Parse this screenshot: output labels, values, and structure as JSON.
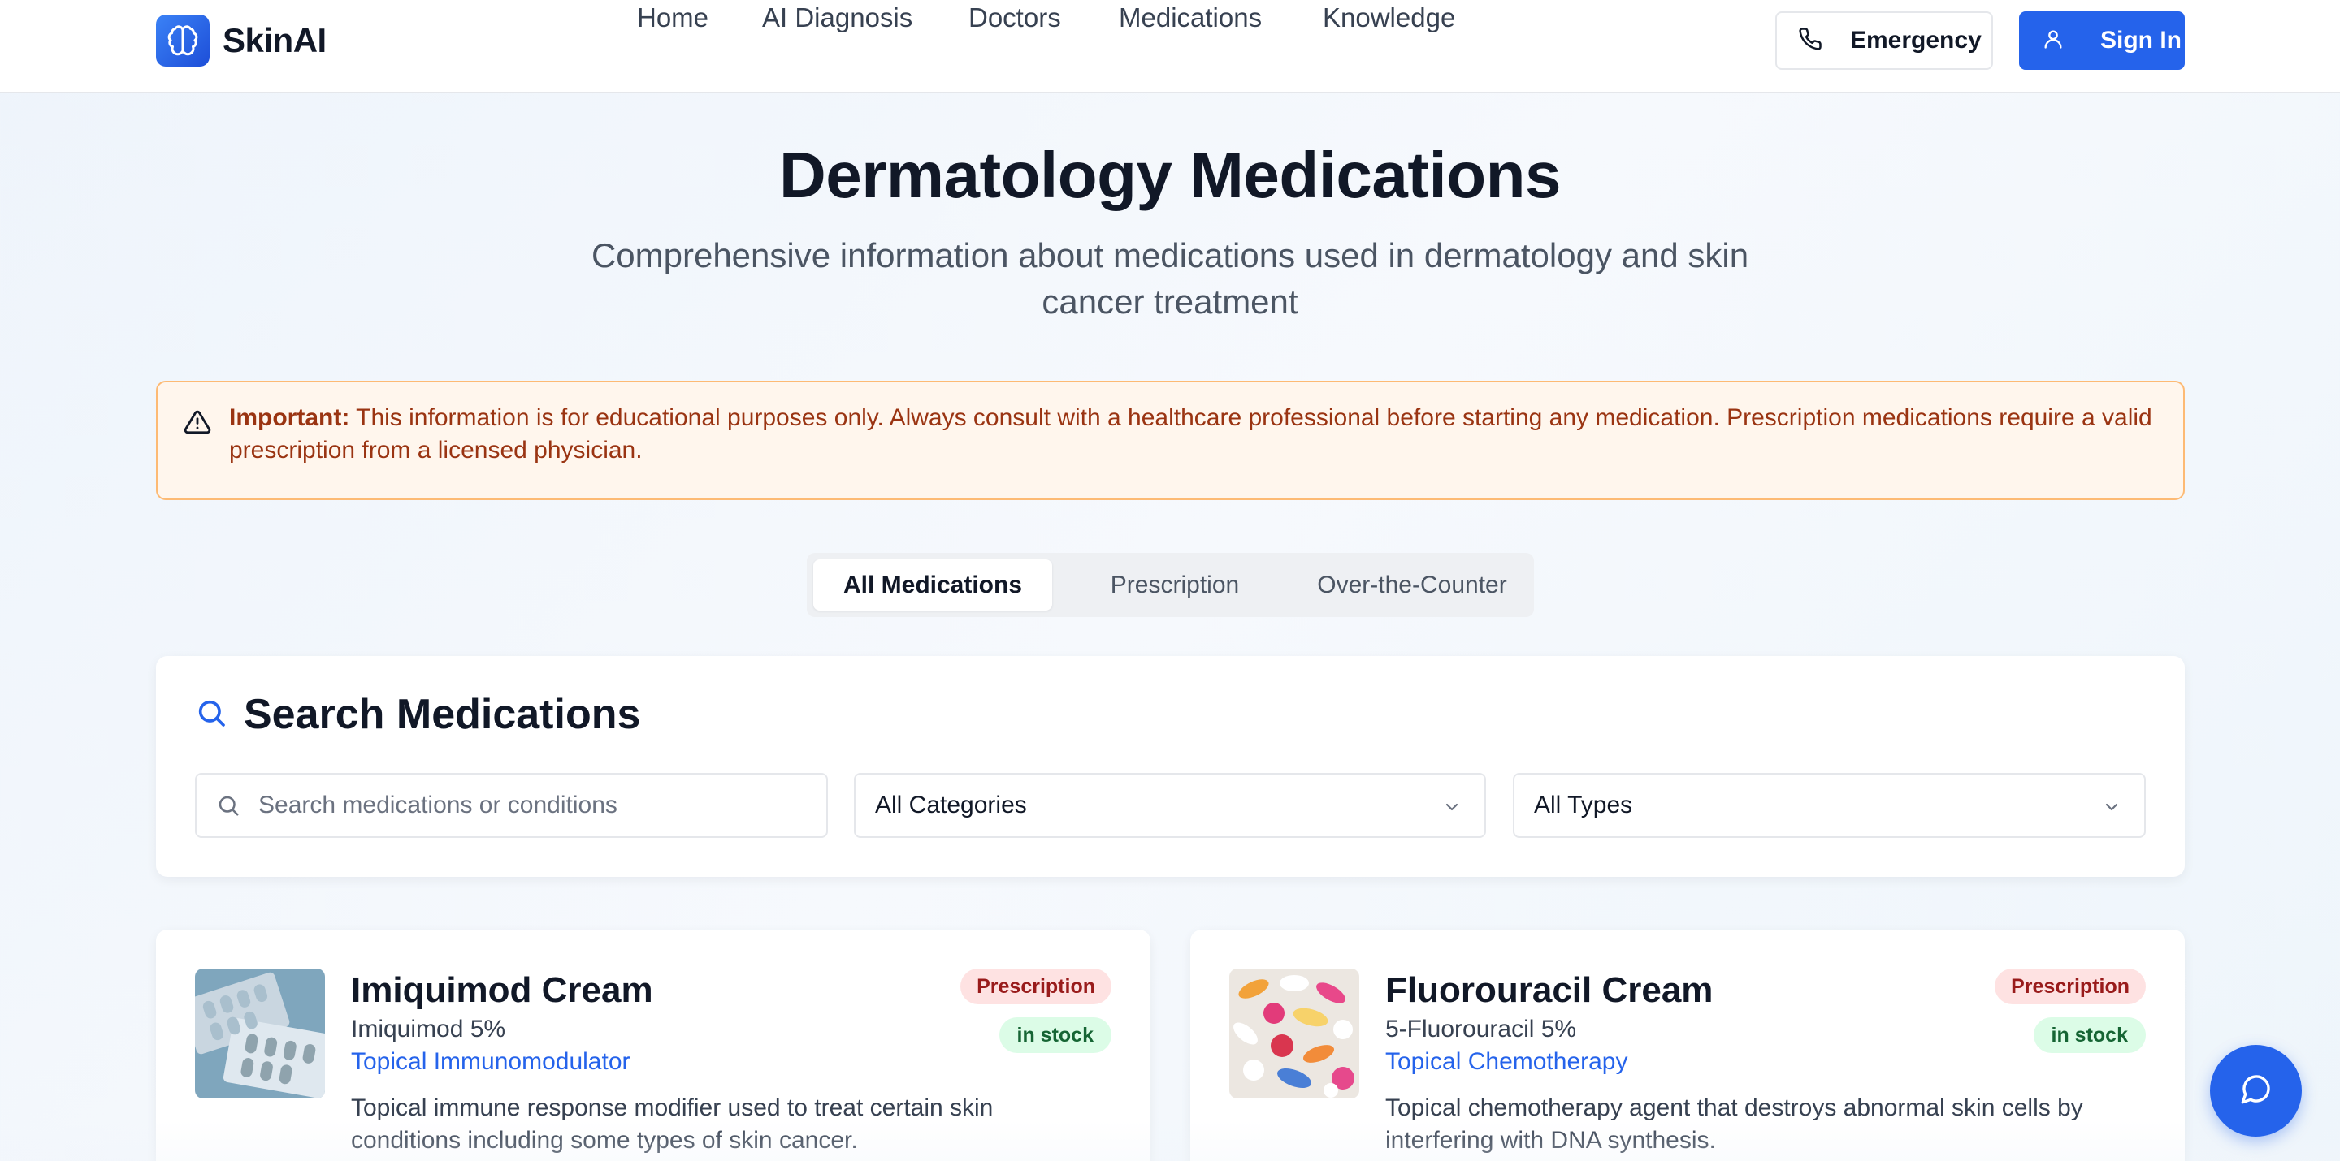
{
  "brand": {
    "name": "SkinAI",
    "logo_icon": "brain-icon",
    "accent": "#2563eb"
  },
  "nav": {
    "items": [
      {
        "label": "Home"
      },
      {
        "label": "AI Diagnosis"
      },
      {
        "label": "Doctors"
      },
      {
        "label": "Medications"
      },
      {
        "label": "Knowledge"
      }
    ]
  },
  "header_actions": {
    "emergency": {
      "label": "Emergency",
      "icon": "phone-icon"
    },
    "sign_in": {
      "label": "Sign In",
      "icon": "user-icon"
    }
  },
  "hero": {
    "title": "Dermatology Medications",
    "subtitle": "Comprehensive information about medications used in dermatology and skin cancer treatment"
  },
  "alert": {
    "icon": "warning-triangle-icon",
    "strong": "Important:",
    "text": " This information is for educational purposes only. Always consult with a healthcare professional before starting any medication. Prescription medications require a valid prescription from a licensed physician."
  },
  "tabs": [
    {
      "label": "All Medications",
      "active": true
    },
    {
      "label": "Prescription",
      "active": false
    },
    {
      "label": "Over-the-Counter",
      "active": false
    }
  ],
  "search": {
    "title": "Search Medications",
    "icon": "search-icon",
    "input_placeholder": "Search medications or conditions",
    "category_select": "All Categories",
    "type_select": "All Types"
  },
  "medications": [
    {
      "name": "Imiquimod Cream",
      "generic": "Imiquimod 5%",
      "drug_class": "Topical Immunomodulator",
      "description": "Topical immune response modifier used to treat certain skin conditions including some types of skin cancer.",
      "type_badge": "Prescription",
      "stock_badge": "in stock"
    },
    {
      "name": "Fluorouracil Cream",
      "generic": "5-Fluorouracil 5%",
      "drug_class": "Topical Chemotherapy",
      "description": "Topical chemotherapy agent that destroys abnormal skin cells by interfering with DNA synthesis.",
      "type_badge": "Prescription",
      "stock_badge": "in stock"
    }
  ],
  "chat": {
    "icon": "chat-bubble-icon"
  }
}
